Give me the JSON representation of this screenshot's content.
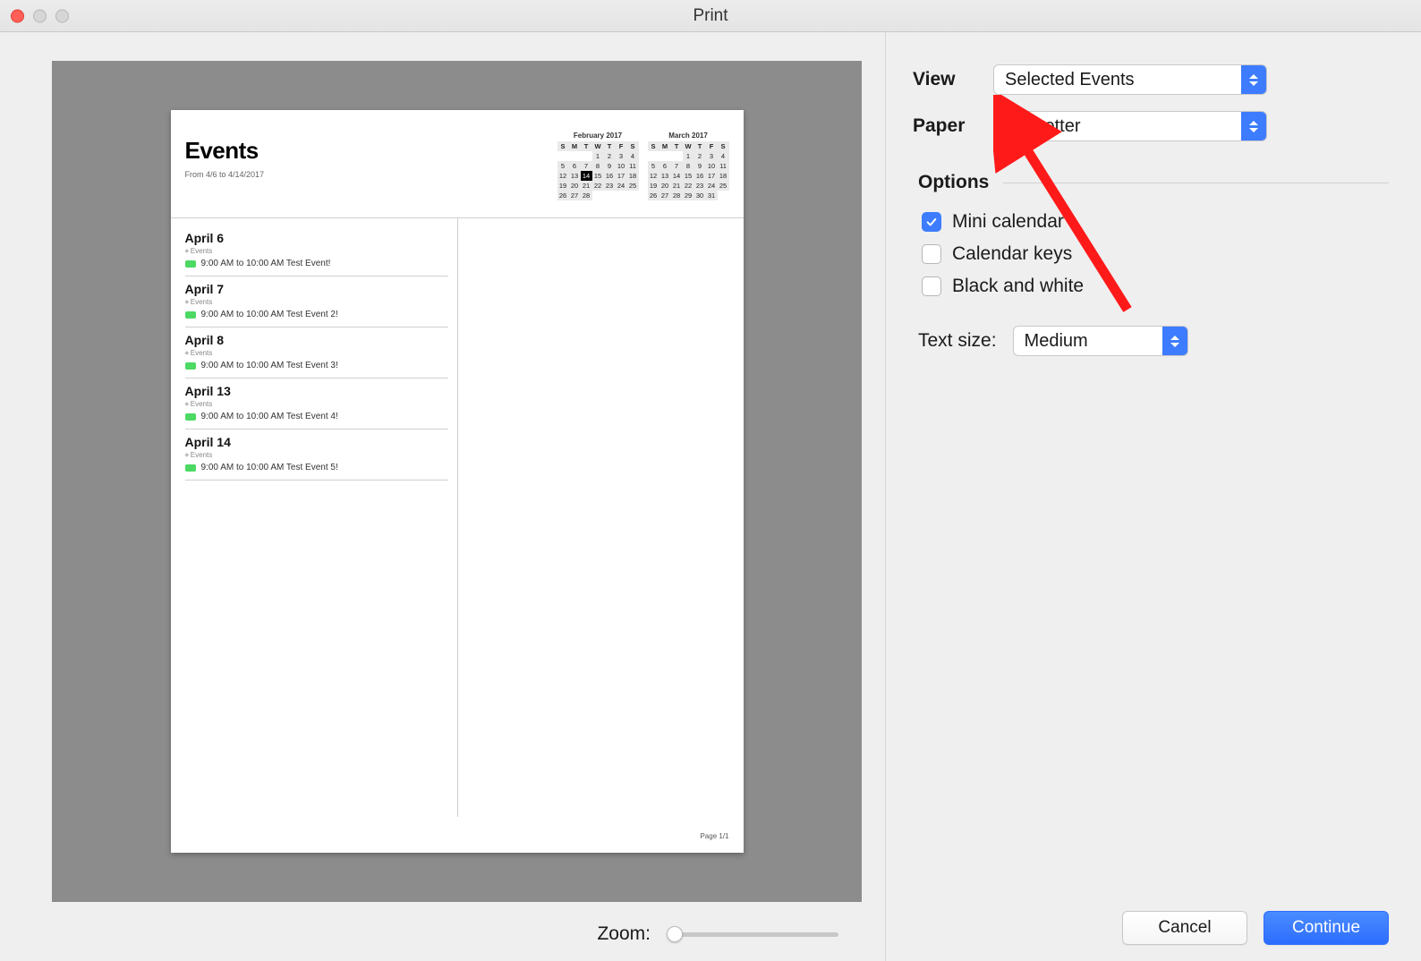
{
  "window": {
    "title": "Print"
  },
  "preview": {
    "page_title": "Events",
    "date_range": "From 4/6 to 4/14/2017",
    "page_footer": "Page 1/1",
    "mini_calendars": [
      {
        "title": "February 2017",
        "dow": [
          "S",
          "M",
          "T",
          "W",
          "T",
          "F",
          "S"
        ],
        "weeks": [
          [
            "",
            "",
            "",
            "1",
            "2",
            "3",
            "4"
          ],
          [
            "5",
            "6",
            "7",
            "8",
            "9",
            "10",
            "11"
          ],
          [
            "12",
            "13",
            "14",
            "15",
            "16",
            "17",
            "18"
          ],
          [
            "19",
            "20",
            "21",
            "22",
            "23",
            "24",
            "25"
          ],
          [
            "26",
            "27",
            "28",
            "",
            "",
            "",
            ""
          ]
        ],
        "today": "14"
      },
      {
        "title": "March 2017",
        "dow": [
          "S",
          "M",
          "T",
          "W",
          "T",
          "F",
          "S"
        ],
        "weeks": [
          [
            "",
            "",
            "",
            "1",
            "2",
            "3",
            "4"
          ],
          [
            "5",
            "6",
            "7",
            "8",
            "9",
            "10",
            "11"
          ],
          [
            "12",
            "13",
            "14",
            "15",
            "16",
            "17",
            "18"
          ],
          [
            "19",
            "20",
            "21",
            "22",
            "23",
            "24",
            "25"
          ],
          [
            "26",
            "27",
            "28",
            "29",
            "30",
            "31",
            ""
          ]
        ]
      }
    ],
    "days": [
      {
        "title": "April 6",
        "category": "Events",
        "event": "9:00 AM to 10:00 AM Test Event!"
      },
      {
        "title": "April 7",
        "category": "Events",
        "event": "9:00 AM to 10:00 AM Test Event 2!"
      },
      {
        "title": "April 8",
        "category": "Events",
        "event": "9:00 AM to 10:00 AM Test Event 3!"
      },
      {
        "title": "April 13",
        "category": "Events",
        "event": "9:00 AM to 10:00 AM Test Event 4!"
      },
      {
        "title": "April 14",
        "category": "Events",
        "event": "9:00 AM to 10:00 AM Test Event 5!"
      }
    ]
  },
  "controls": {
    "zoom_label": "Zoom:"
  },
  "sidebar": {
    "view_label": "View",
    "view_value": "Selected Events",
    "paper_label": "Paper",
    "paper_value": "US Letter",
    "options_header": "Options",
    "checks": [
      {
        "label": "Mini calendar",
        "checked": true
      },
      {
        "label": "Calendar keys",
        "checked": false
      },
      {
        "label": "Black and white",
        "checked": false
      }
    ],
    "text_size_label": "Text size:",
    "text_size_value": "Medium"
  },
  "buttons": {
    "cancel": "Cancel",
    "continue": "Continue"
  }
}
